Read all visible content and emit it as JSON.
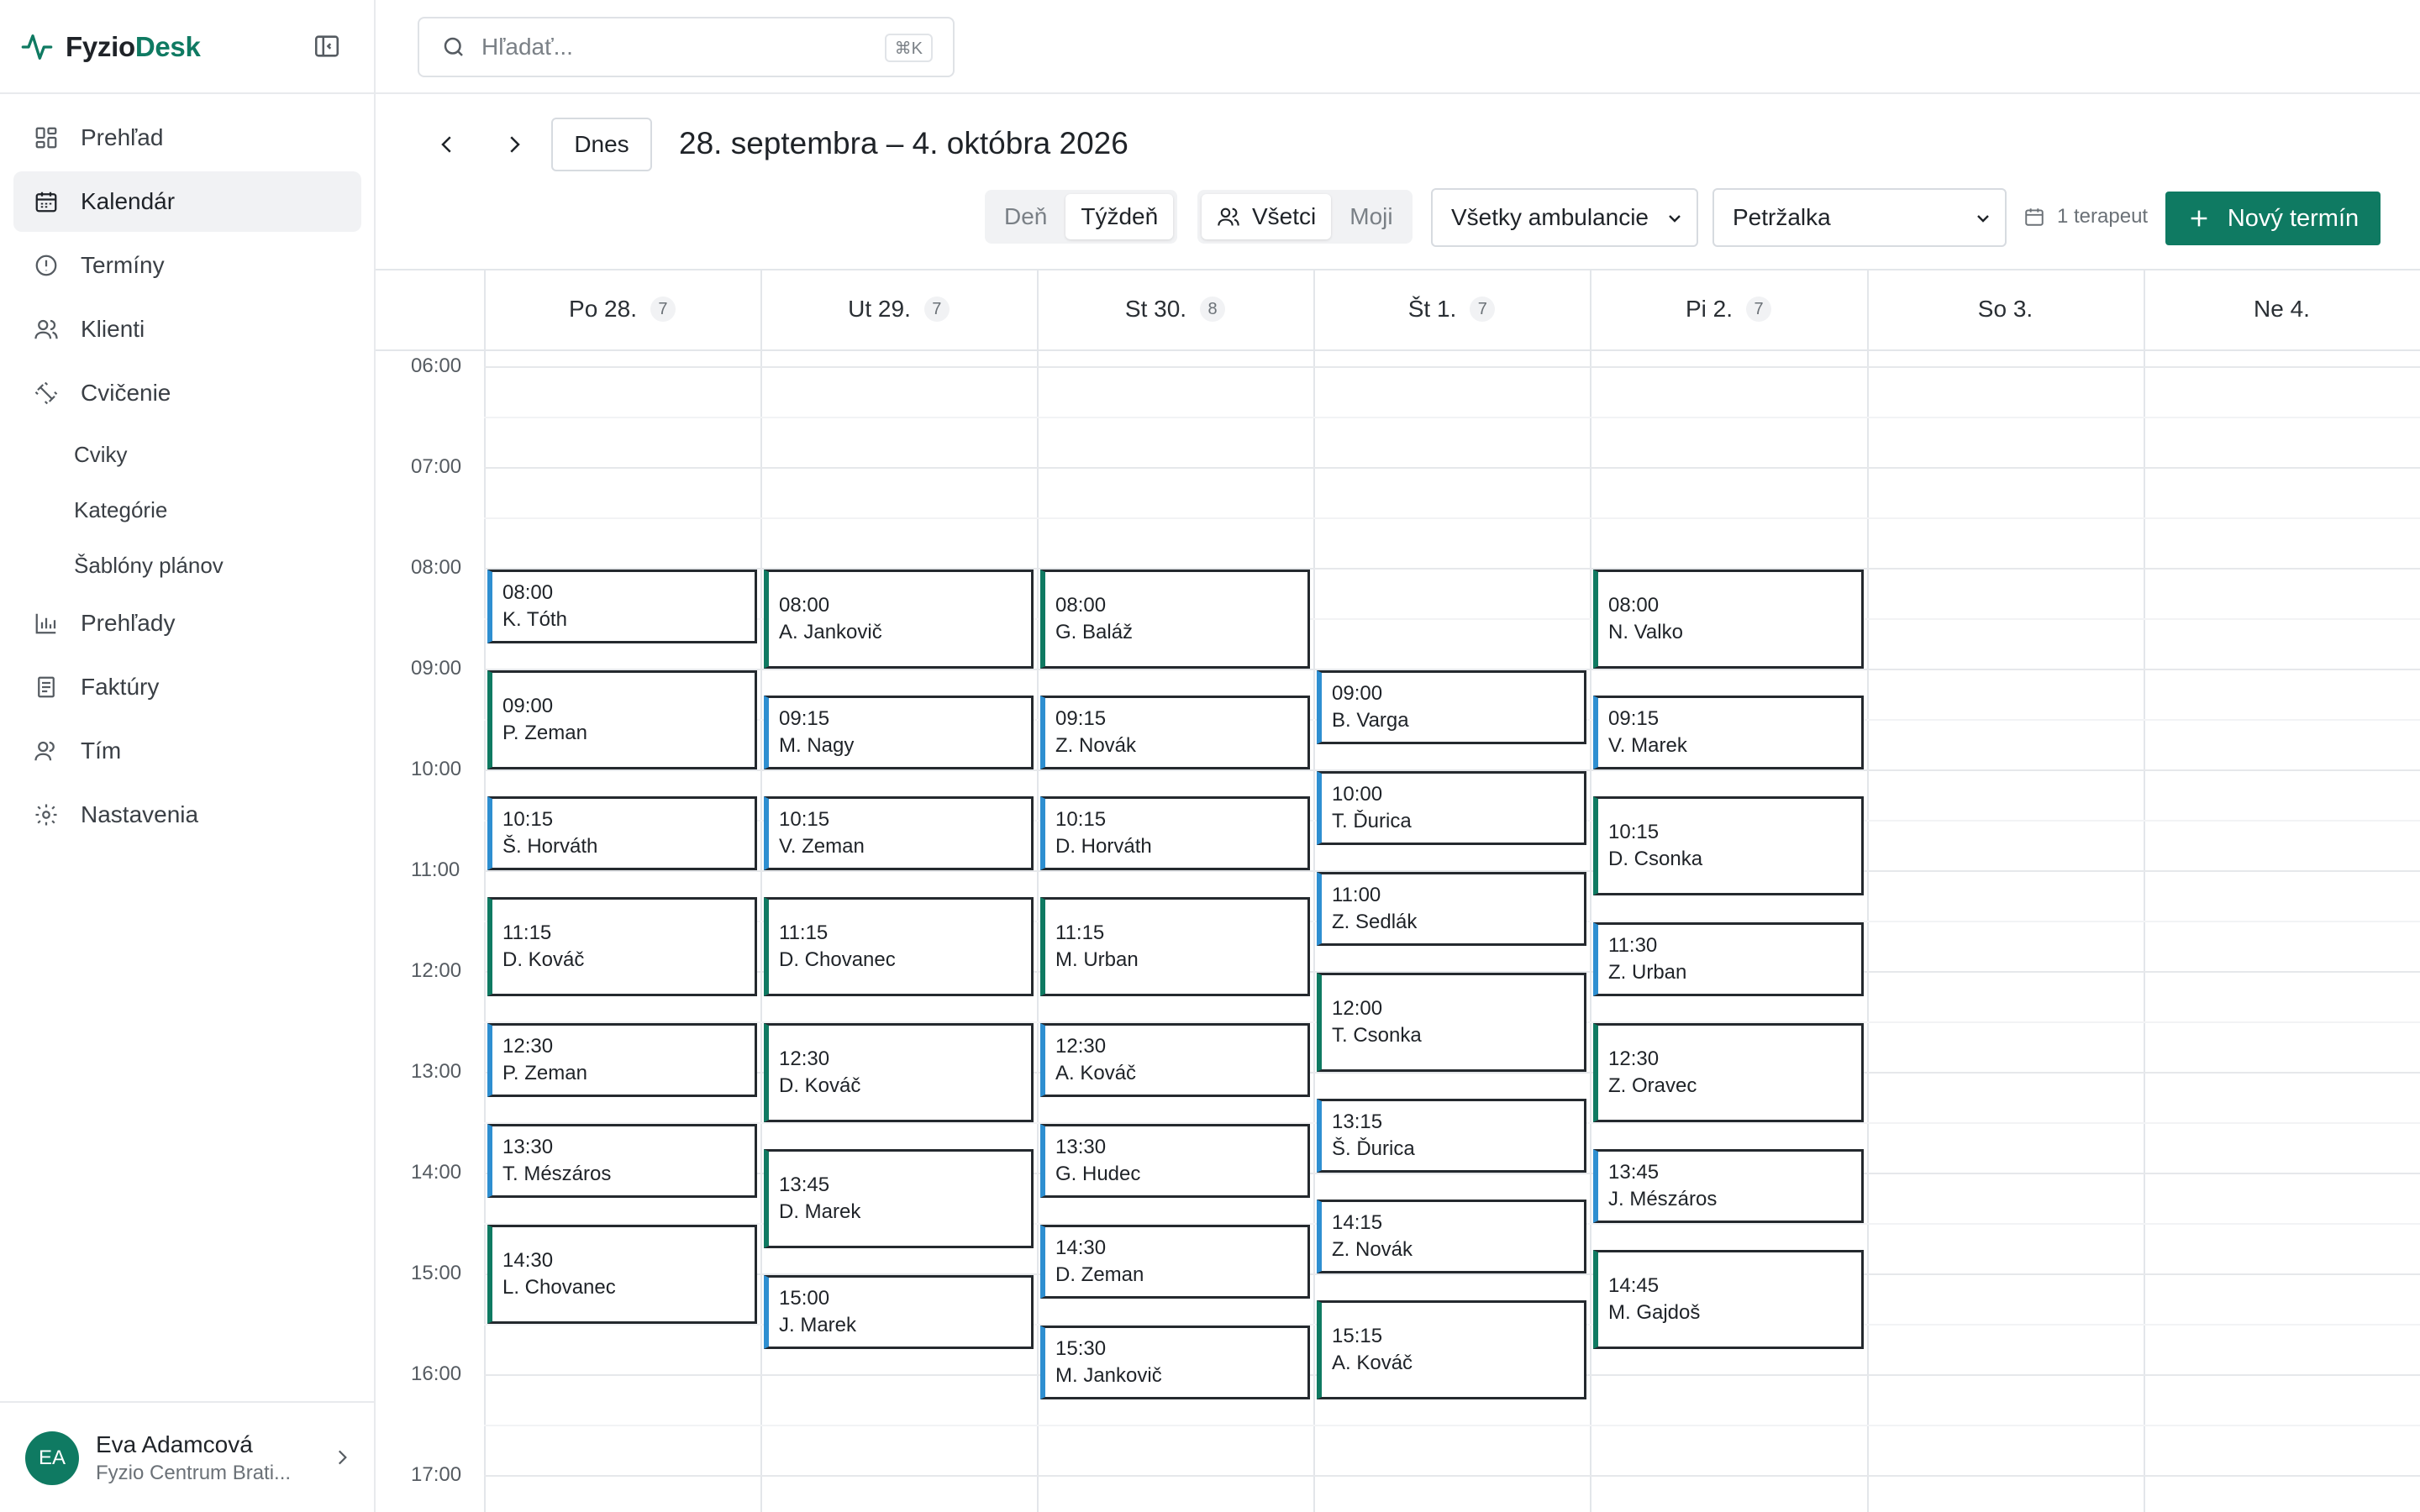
{
  "brand": {
    "name_a": "Fyzio",
    "name_b": "Desk",
    "accent": "#0f7a62"
  },
  "sidebar": {
    "items": [
      {
        "label": "Prehľad",
        "icon": "dashboard-icon"
      },
      {
        "label": "Kalendár",
        "icon": "calendar-icon",
        "active": true
      },
      {
        "label": "Termíny",
        "icon": "alert-circle-icon"
      },
      {
        "label": "Klienti",
        "icon": "users-icon"
      },
      {
        "label": "Cvičenie",
        "icon": "dumbbell-icon"
      }
    ],
    "sub_items": [
      "Cviky",
      "Kategórie",
      "Šablóny plánov"
    ],
    "items_after": [
      {
        "label": "Prehľady",
        "icon": "bar-chart-icon"
      },
      {
        "label": "Faktúry",
        "icon": "invoice-icon"
      },
      {
        "label": "Tím",
        "icon": "team-icon"
      },
      {
        "label": "Nastavenia",
        "icon": "gear-icon"
      }
    ]
  },
  "user": {
    "initials": "EA",
    "name": "Eva Adamcová",
    "org": "Fyzio Centrum Brati..."
  },
  "search": {
    "placeholder": "Hľadať...",
    "shortcut": "⌘K"
  },
  "toolbar": {
    "today": "Dnes",
    "range": "28. septembra – 4. októbra 2026",
    "view_day": "Deň",
    "view_week": "Týždeň",
    "filter_all": "Všetci",
    "filter_mine": "Moji",
    "clinic_select": "Všetky ambulancie",
    "branch_select": "Petržalka",
    "therapist_count": "1 terapeut",
    "new_button": "Nový termín"
  },
  "calendar": {
    "days": [
      {
        "label": "Po 28.",
        "count": "7"
      },
      {
        "label": "Ut 29.",
        "count": "7"
      },
      {
        "label": "St 30.",
        "count": "8"
      },
      {
        "label": "Št 1.",
        "count": "7"
      },
      {
        "label": "Pi 2.",
        "count": "7"
      },
      {
        "label": "So 3.",
        "count": ""
      },
      {
        "label": "Ne 4.",
        "count": ""
      }
    ],
    "hours": [
      "06:00",
      "07:00",
      "08:00",
      "09:00",
      "10:00",
      "11:00",
      "12:00",
      "13:00",
      "14:00",
      "15:00",
      "16:00",
      "17:00"
    ],
    "appointments": [
      {
        "day": 0,
        "time": "08:00",
        "name": "K. Tóth",
        "dur": 45,
        "style": "blue"
      },
      {
        "day": 0,
        "time": "09:00",
        "name": "P. Zeman",
        "dur": 60,
        "style": "green"
      },
      {
        "day": 0,
        "time": "10:15",
        "name": "Š. Horváth",
        "dur": 45,
        "style": "blue"
      },
      {
        "day": 0,
        "time": "11:15",
        "name": "D. Kováč",
        "dur": 60,
        "style": "green"
      },
      {
        "day": 0,
        "time": "12:30",
        "name": "P. Zeman",
        "dur": 45,
        "style": "blue"
      },
      {
        "day": 0,
        "time": "13:30",
        "name": "T. Mészáros",
        "dur": 45,
        "style": "blue"
      },
      {
        "day": 0,
        "time": "14:30",
        "name": "L. Chovanec",
        "dur": 60,
        "style": "green"
      },
      {
        "day": 1,
        "time": "08:00",
        "name": "A. Jankovič",
        "dur": 60,
        "style": "green"
      },
      {
        "day": 1,
        "time": "09:15",
        "name": "M. Nagy",
        "dur": 45,
        "style": "blue"
      },
      {
        "day": 1,
        "time": "10:15",
        "name": "V. Zeman",
        "dur": 45,
        "style": "blue"
      },
      {
        "day": 1,
        "time": "11:15",
        "name": "D. Chovanec",
        "dur": 60,
        "style": "green"
      },
      {
        "day": 1,
        "time": "12:30",
        "name": "D. Kováč",
        "dur": 60,
        "style": "green"
      },
      {
        "day": 1,
        "time": "13:45",
        "name": "D. Marek",
        "dur": 60,
        "style": "green"
      },
      {
        "day": 1,
        "time": "15:00",
        "name": "J. Marek",
        "dur": 45,
        "style": "blue"
      },
      {
        "day": 2,
        "time": "08:00",
        "name": "G. Baláž",
        "dur": 60,
        "style": "green"
      },
      {
        "day": 2,
        "time": "09:15",
        "name": "Z. Novák",
        "dur": 45,
        "style": "blue"
      },
      {
        "day": 2,
        "time": "10:15",
        "name": "D. Horváth",
        "dur": 45,
        "style": "blue"
      },
      {
        "day": 2,
        "time": "11:15",
        "name": "M. Urban",
        "dur": 60,
        "style": "green"
      },
      {
        "day": 2,
        "time": "12:30",
        "name": "A. Kováč",
        "dur": 45,
        "style": "blue"
      },
      {
        "day": 2,
        "time": "13:30",
        "name": "G. Hudec",
        "dur": 45,
        "style": "blue"
      },
      {
        "day": 2,
        "time": "14:30",
        "name": "D. Zeman",
        "dur": 45,
        "style": "blue"
      },
      {
        "day": 2,
        "time": "15:30",
        "name": "M. Jankovič",
        "dur": 45,
        "style": "blue"
      },
      {
        "day": 3,
        "time": "09:00",
        "name": "B. Varga",
        "dur": 45,
        "style": "blue"
      },
      {
        "day": 3,
        "time": "10:00",
        "name": "T. Ďurica",
        "dur": 45,
        "style": "blue"
      },
      {
        "day": 3,
        "time": "11:00",
        "name": "Z. Sedlák",
        "dur": 45,
        "style": "blue"
      },
      {
        "day": 3,
        "time": "12:00",
        "name": "T. Csonka",
        "dur": 60,
        "style": "green"
      },
      {
        "day": 3,
        "time": "13:15",
        "name": "Š. Ďurica",
        "dur": 45,
        "style": "blue"
      },
      {
        "day": 3,
        "time": "14:15",
        "name": "Z. Novák",
        "dur": 45,
        "style": "blue"
      },
      {
        "day": 3,
        "time": "15:15",
        "name": "A. Kováč",
        "dur": 60,
        "style": "green"
      },
      {
        "day": 4,
        "time": "08:00",
        "name": "N. Valko",
        "dur": 60,
        "style": "green"
      },
      {
        "day": 4,
        "time": "09:15",
        "name": "V. Marek",
        "dur": 45,
        "style": "blue"
      },
      {
        "day": 4,
        "time": "10:15",
        "name": "D. Csonka",
        "dur": 60,
        "style": "green"
      },
      {
        "day": 4,
        "time": "11:30",
        "name": "Z. Urban",
        "dur": 45,
        "style": "blue"
      },
      {
        "day": 4,
        "time": "12:30",
        "name": "Z. Oravec",
        "dur": 60,
        "style": "green"
      },
      {
        "day": 4,
        "time": "13:45",
        "name": "J. Mészáros",
        "dur": 45,
        "style": "blue"
      },
      {
        "day": 4,
        "time": "14:45",
        "name": "M. Gajdoš",
        "dur": 60,
        "style": "green"
      }
    ]
  }
}
